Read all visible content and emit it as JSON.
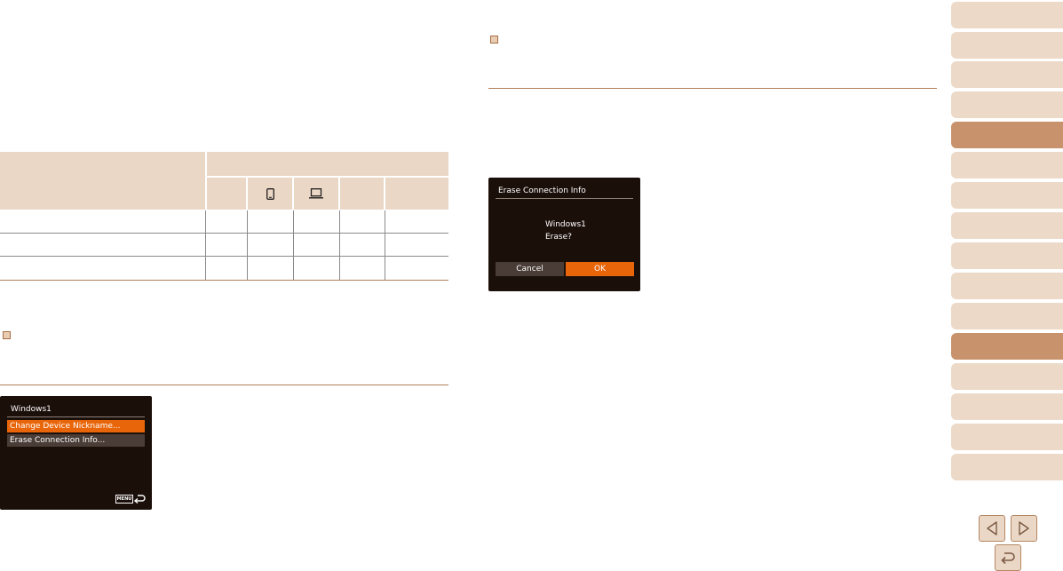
{
  "comm_table": {
    "icon_columns": [
      "smartphone-icon",
      "computer-icon"
    ],
    "row_count": 3
  },
  "nickname_menu_screen": {
    "title": "Windows1",
    "items": [
      {
        "label": "Change Device Nickname...",
        "selected": true
      },
      {
        "label": "Erase Connection Info...",
        "selected": false
      }
    ],
    "menu_badge": "MENU",
    "back_icon": "return-arrow-icon"
  },
  "erase_dialog_screen": {
    "title": "Erase Connection Info",
    "message_line1": "Windows1",
    "message_line2": "Erase?",
    "cancel_label": "Cancel",
    "ok_label": "OK"
  },
  "sidebar": {
    "tab_count": 15,
    "active_tabs": [
      4,
      11
    ]
  },
  "navigation": {
    "prev_icon": "triangle-left-icon",
    "next_icon": "triangle-right-icon",
    "return_icon": "return-arrow-icon"
  },
  "colors": {
    "accent_orange": "#e8650a",
    "table_header_beige": "#ead7c5",
    "tab_beige": "#ecd9c7",
    "tab_active": "#c8936c",
    "rule_brown": "#b07f5a",
    "screen_bg": "#1b0f0a"
  }
}
